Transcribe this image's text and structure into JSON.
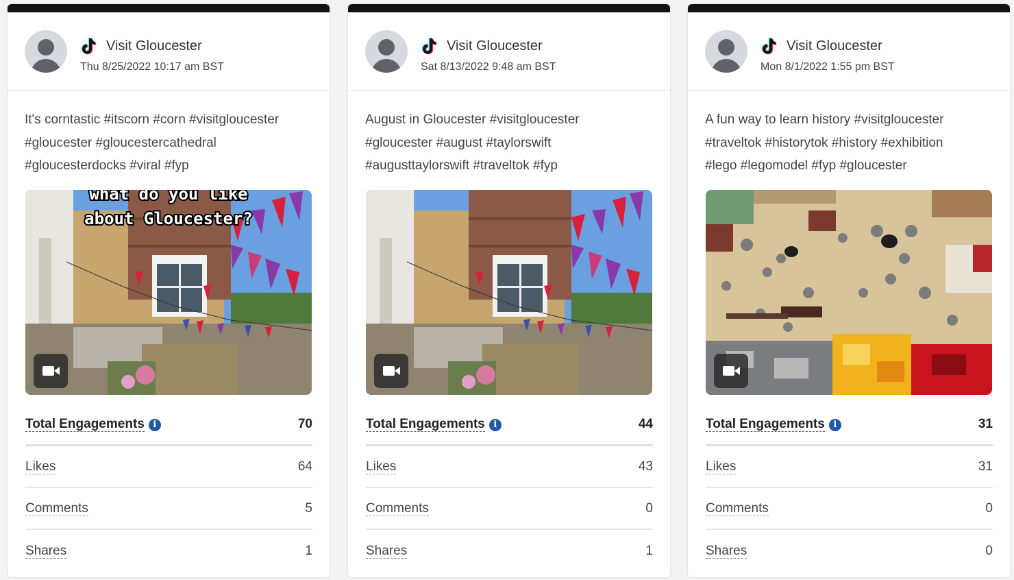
{
  "posts": [
    {
      "account": "Visit Gloucester",
      "platform_icon": "tiktok-icon",
      "timestamp": "Thu 8/25/2022 10:17 am BST",
      "caption_lines": [
        "It's corntastic #itscorn #corn #visitgloucester",
        "#gloucester #gloucestercathedral",
        "#gloucesterdocks #viral #fyp"
      ],
      "media_overlay_text": [
        "what do you like",
        "about Gloucester?"
      ],
      "media_type_icon": "video-camera-icon",
      "metrics": {
        "total_label": "Total Engagements",
        "total": "70",
        "likes_label": "Likes",
        "likes": "64",
        "comments_label": "Comments",
        "comments": "5",
        "shares_label": "Shares",
        "shares": "1"
      }
    },
    {
      "account": "Visit Gloucester",
      "platform_icon": "tiktok-icon",
      "timestamp": "Sat 8/13/2022 9:48 am BST",
      "caption_lines": [
        "August in Gloucester #visitgloucester",
        "#gloucester #august #taylorswift",
        "#augusttaylorswift #traveltok #fyp"
      ],
      "media_type_icon": "video-camera-icon",
      "metrics": {
        "total_label": "Total Engagements",
        "total": "44",
        "likes_label": "Likes",
        "likes": "43",
        "comments_label": "Comments",
        "comments": "0",
        "shares_label": "Shares",
        "shares": "1"
      }
    },
    {
      "account": "Visit Gloucester",
      "platform_icon": "tiktok-icon",
      "timestamp": "Mon 8/1/2022 1:55 pm BST",
      "caption_lines": [
        "A fun way to learn history #visitgloucester",
        "#traveltok #historytok #history #exhibition",
        "#lego #legomodel #fyp #gloucester"
      ],
      "media_type_icon": "video-camera-icon",
      "metrics": {
        "total_label": "Total Engagements",
        "total": "31",
        "likes_label": "Likes",
        "likes": "31",
        "comments_label": "Comments",
        "comments": "0",
        "shares_label": "Shares",
        "shares": "0"
      }
    }
  ],
  "colors": {
    "card_topbar": "#111111",
    "info_icon": "#1e5aa8",
    "page_background": "#f3f3f3"
  }
}
